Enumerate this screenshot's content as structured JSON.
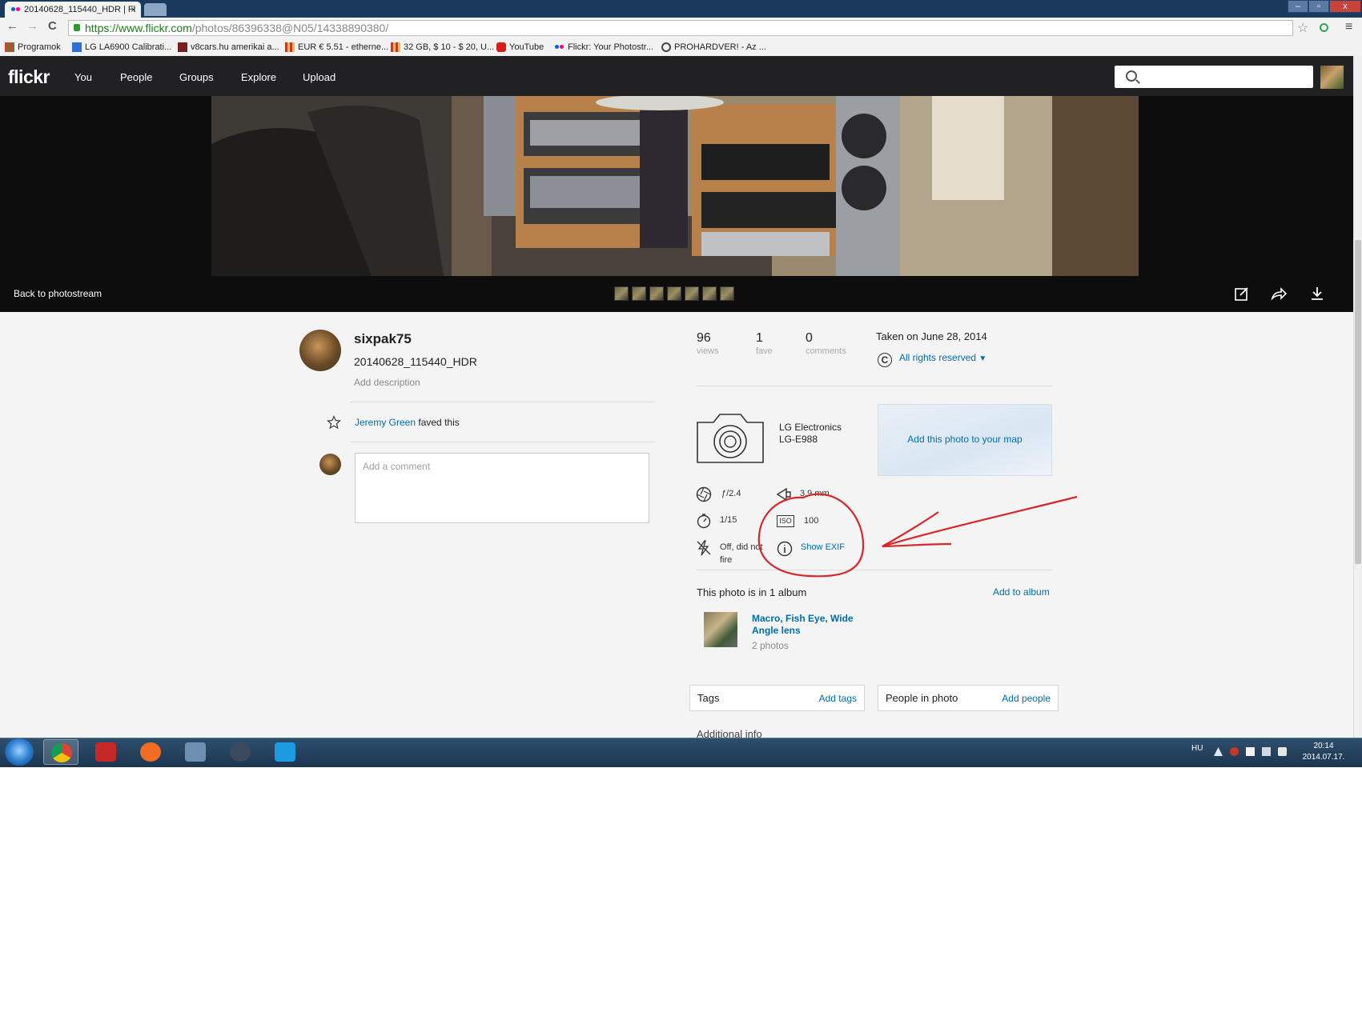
{
  "browser": {
    "tab_title": "20140628_115440_HDR | Fl",
    "tab_close": "×",
    "url_https": "https://www.flickr.com",
    "url_path": "/photos/86396338@N05/14338890380/",
    "nav_back": "←",
    "nav_forward": "→",
    "nav_reload": "C",
    "star": "☆",
    "menu": "≡",
    "win_min": "–",
    "win_max": "▫",
    "win_close": "x",
    "bookmarks": [
      {
        "label": "Programok",
        "icon_color": "#d4442f"
      },
      {
        "label": "LG LA6900 Calibrati...",
        "icon_color": "#2f6fd4"
      },
      {
        "label": "v8cars.hu amerikai a...",
        "icon_color": "#7a1f1f"
      },
      {
        "label": "EUR € 5.51 - etherne...",
        "icon_color": "#c0392b"
      },
      {
        "label": "32 GB, $ 10 - $ 20, U...",
        "icon_color": "#c0392b"
      },
      {
        "label": "YouTube",
        "icon_color": "#d91e18"
      },
      {
        "label": "Flickr: Your Photostr...",
        "icon_color": "#ff0084"
      },
      {
        "label": "PROHARDVER! - Az ...",
        "icon_color": "#444444"
      }
    ]
  },
  "flickr": {
    "logo": "flickr",
    "nav": [
      "You",
      "People",
      "Groups",
      "Explore",
      "Upload"
    ],
    "back_to_photostream": "Back to photostream"
  },
  "photo": {
    "owner": "sixpak75",
    "title": "20140628_115440_HDR",
    "add_description": "Add description",
    "faved_by": "Jeremy Green",
    "faved_suffix": "faved this",
    "comment_placeholder": "Add a comment",
    "stats": [
      {
        "value": "96",
        "label": "views"
      },
      {
        "value": "1",
        "label": "fave"
      },
      {
        "value": "0",
        "label": "comments"
      }
    ],
    "taken": "Taken on June 28, 2014",
    "copyright_symbol": "C",
    "license": "All rights reserved",
    "camera_make": "LG Electronics",
    "camera_model": "LG-E988",
    "map_label": "Add this photo to your map",
    "exif": {
      "aperture": "ƒ/2.4",
      "focal_length": "3.9 mm",
      "shutter": "1/15",
      "iso_label": "ISO",
      "iso": "100",
      "flash_line1": "Off, did not",
      "flash_line2": "fire",
      "show_exif": "Show EXIF"
    },
    "album_heading": "This photo is in 1 album",
    "add_to_album": "Add to album",
    "album_name_line1": "Macro, Fish Eye, Wide",
    "album_name_line2": "Angle lens",
    "album_count": "2 photos",
    "tags_label": "Tags",
    "add_tags": "Add tags",
    "people_label": "People in photo",
    "add_people": "Add people",
    "additional_info": "Additional info"
  },
  "taskbar": {
    "lang": "HU",
    "time": "20:14",
    "date": "2014.07.17.",
    "apps": [
      {
        "name": "chrome",
        "color": "#e8b21f",
        "active": true
      },
      {
        "name": "flash",
        "color": "#c62828",
        "active": false
      },
      {
        "name": "origin",
        "color": "#f26c22",
        "active": false
      },
      {
        "name": "app99",
        "color": "#6d8fb0",
        "active": false
      },
      {
        "name": "steam",
        "color": "#3a4a5c",
        "active": false
      },
      {
        "name": "uplay",
        "color": "#1d9be0",
        "active": false
      }
    ]
  },
  "colors": {
    "flickr_nav": "#212124",
    "link": "#006dac",
    "annotation_red": "#d8262b"
  }
}
